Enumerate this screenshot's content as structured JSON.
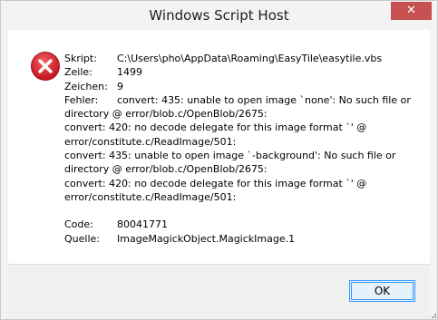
{
  "window": {
    "title": "Windows Script Host",
    "close_label": "✕"
  },
  "details": {
    "script_label": "Skript:",
    "script_value": "C:\\Users\\pho\\AppData\\Roaming\\EasyTile\\easytile.vbs",
    "line_label": "Zeile:",
    "line_value": "1499",
    "char_label": "Zeichen:",
    "char_value": "9",
    "error_label": "Fehler:",
    "error_lines": [
      "convert: 435: unable to open image `none': No such file or",
      "directory @ error/blob.c/OpenBlob/2675:",
      "convert: 420: no decode delegate for this image format `' @",
      "error/constitute.c/ReadImage/501:",
      "convert: 435: unable to open image `-background': No such file or",
      "directory @ error/blob.c/OpenBlob/2675:",
      "convert: 420: no decode delegate for this image format `' @",
      "error/constitute.c/ReadImage/501:"
    ],
    "code_label": "Code:",
    "code_value": "80041771",
    "source_label": "Quelle:",
    "source_value": "ImageMagickObject.MagickImage.1"
  },
  "buttons": {
    "ok_label": "OK"
  },
  "icons": {
    "dialog_icon": "error-icon",
    "close_icon": "close-icon"
  },
  "colors": {
    "error_red": "#d9252d",
    "close_bg": "#c75050",
    "focus_blue": "#3399ff"
  }
}
